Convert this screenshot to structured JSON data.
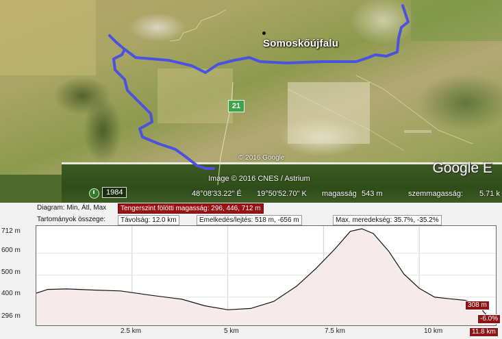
{
  "map": {
    "village_name": "Somoskőújfalu",
    "road_number": "21",
    "map_copyright": "© 2016 Google",
    "image_credit": "Image © 2016 CNES / Astrium",
    "logo": "Google E",
    "history_year": "1984",
    "history_icon": "clock-icon",
    "route_color": "#4a52e0"
  },
  "status": {
    "latitude": "48°08'33.22\" É",
    "longitude": "19°50'52.70\" K",
    "elevation_label": "magasság",
    "elevation_value": "543 m",
    "eye_altitude_label": "szemmagasság:",
    "eye_altitude_value": "5.71 k"
  },
  "profile": {
    "diagram_label": "Diagram: Min, Átl, Max",
    "altitude_stat": "Tengerszint fölötti magasság: 296, 446, 712 m",
    "range_label": "Tartományok összege:",
    "distance_stat": "Távolság: 12.0 km",
    "gain_loss_stat": "Emelkedés/lejtés: 518 m, -656 m",
    "slope_stat": "Max. meredekség: 35.7%, -35.2%",
    "y_ticks": [
      "712 m",
      "600 m",
      "500 m",
      "400 m",
      "296 m"
    ],
    "x_ticks": [
      "2.5 km",
      "5 km",
      "7.5 km",
      "10 km"
    ],
    "end_altitude": "308 m",
    "end_slope": "-6.0%",
    "end_distance": "11.8 km",
    "accent_color": "#9a1212"
  },
  "chart_data": {
    "type": "area",
    "xlabel": "",
    "ylabel": "",
    "xlim": [
      0,
      12.0
    ],
    "ylim": [
      296,
      712
    ],
    "x": [
      0,
      0.3,
      0.8,
      1.5,
      2.2,
      3.0,
      3.8,
      4.4,
      5.0,
      5.6,
      6.2,
      6.8,
      7.3,
      7.8,
      8.2,
      8.5,
      8.8,
      9.2,
      9.6,
      10.0,
      10.4,
      10.8,
      11.2,
      11.5,
      11.8,
      12.0
    ],
    "values": [
      418,
      435,
      437,
      432,
      428,
      408,
      390,
      360,
      342,
      348,
      380,
      450,
      530,
      620,
      700,
      712,
      690,
      610,
      505,
      440,
      400,
      392,
      385,
      372,
      308,
      300
    ]
  }
}
